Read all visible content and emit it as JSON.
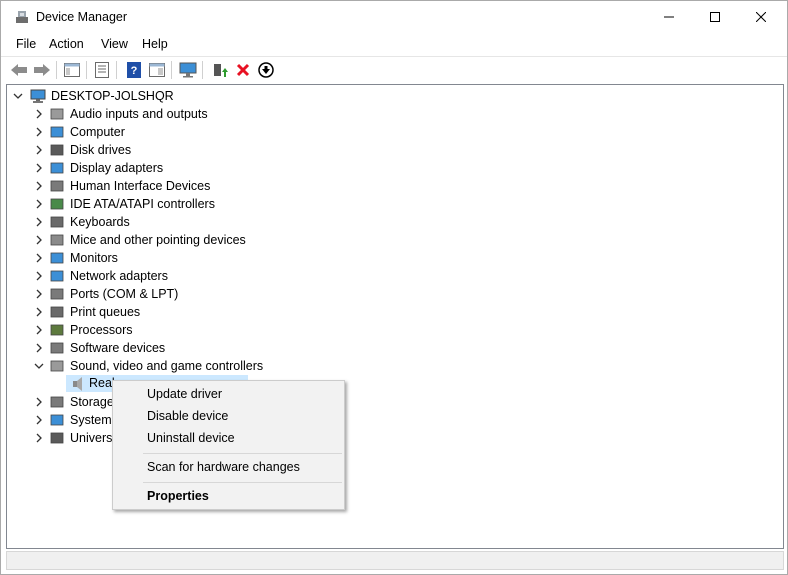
{
  "window": {
    "title": "Device Manager",
    "minimize_glyph": "—",
    "maximize_glyph": "☐",
    "close_glyph": "✕"
  },
  "menu": [
    "File",
    "Action",
    "View",
    "Help"
  ],
  "toolbar": {
    "buttons": [
      "back-icon",
      "forward-icon",
      "show-hide-console-tree-icon",
      "properties-icon",
      "help-icon",
      "action-pane-icon",
      "scan-hardware-icon",
      "update-driver-icon",
      "uninstall-icon",
      "disable-device-icon"
    ]
  },
  "tree": {
    "root": "DESKTOP-JOLSHQR",
    "categories": [
      "Audio inputs and outputs",
      "Computer",
      "Disk drives",
      "Display adapters",
      "Human Interface Devices",
      "IDE ATA/ATAPI controllers",
      "Keyboards",
      "Mice and other pointing devices",
      "Monitors",
      "Network adapters",
      "Ports (COM & LPT)",
      "Print queues",
      "Processors",
      "Software devices",
      "Sound, video and game controllers",
      "Storage",
      "System",
      "Universa"
    ],
    "selected_child": "Real"
  },
  "context_menu": {
    "items": [
      "Update driver",
      "Disable device",
      "Uninstall device",
      "Scan for hardware changes",
      "Properties"
    ]
  },
  "colors": {
    "selection": "#cce8ff",
    "uninstall_red": "#e81123",
    "help_blue": "#1f4fa8",
    "icon_blue": "#3c8fd6"
  }
}
